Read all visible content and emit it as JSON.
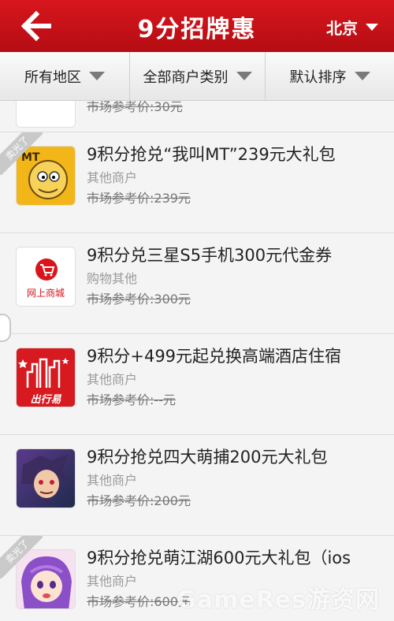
{
  "header": {
    "title": "9分招牌惠",
    "city": "北京",
    "colors": {
      "brand": "#c8121a"
    }
  },
  "filters": [
    {
      "label": "所有地区"
    },
    {
      "label": "全部商户类别"
    },
    {
      "label": "默认排序"
    }
  ],
  "partial_item": {
    "price_text": "市场参考价:30元"
  },
  "items": [
    {
      "title": "9积分抢兑“我叫MT”239元大礼包",
      "category": "其他商户",
      "price_text": "市场参考价:239元",
      "badge": "卖光了",
      "icon": "mt-game-icon"
    },
    {
      "title": "9积分兑三星S5手机300元代金券",
      "category": "购物其他",
      "price_text": "市场参考价:300元",
      "badge": "",
      "icon": "online-mall-icon",
      "icon_text": "网上商城"
    },
    {
      "title": "9积分+499元起兑换高端酒店住宿",
      "category": "其他商户",
      "price_text": "市场参考价:--元",
      "badge": "",
      "icon": "travel-icon",
      "icon_text": "出行易"
    },
    {
      "title": "9积分抢兑四大萌捕200元大礼包",
      "category": "其他商户",
      "price_text": "市场参考价:200元",
      "badge": "",
      "icon": "game-character-icon"
    },
    {
      "title": "9积分抢兑萌江湖600元大礼包（ios",
      "category": "其他商户",
      "price_text": "市场参考价:600元",
      "badge": "卖光了",
      "icon": "anime-girl-icon"
    }
  ],
  "watermark": "GameRes游资网"
}
